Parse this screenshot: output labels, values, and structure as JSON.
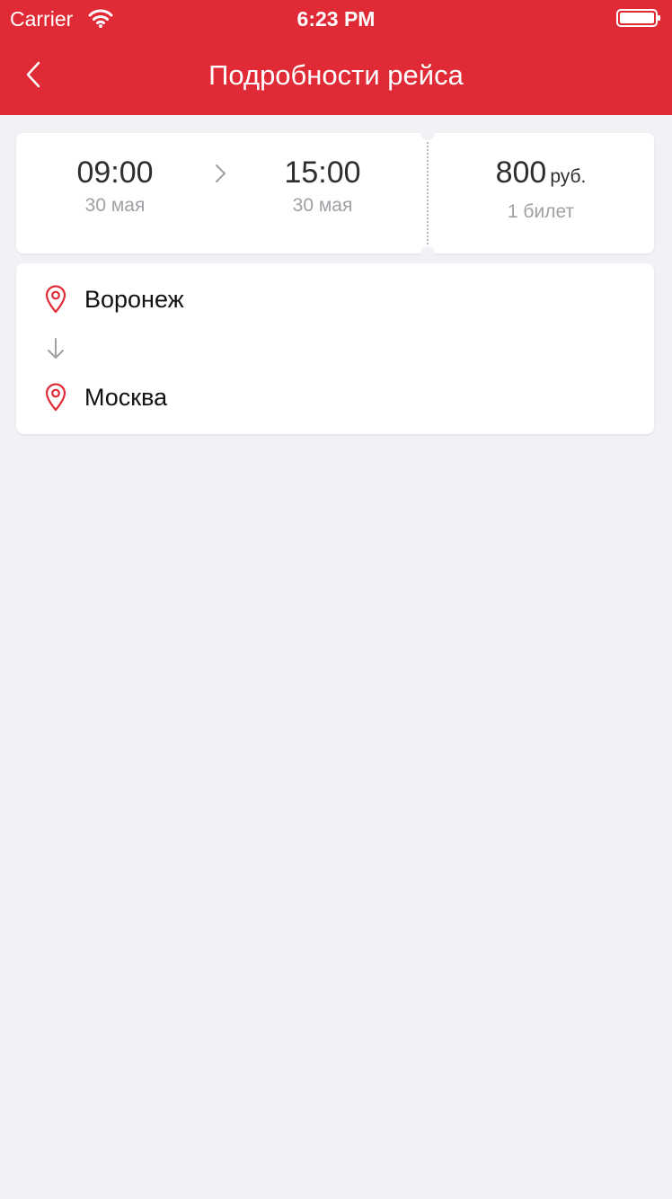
{
  "status_bar": {
    "carrier": "Carrier",
    "time": "6:23 PM",
    "wifi_icon": "wifi-icon",
    "battery_icon": "battery-icon"
  },
  "nav": {
    "title": "Подробности рейса",
    "back_icon": "chevron-left-icon"
  },
  "trip": {
    "departure": {
      "time": "09:00",
      "date": "30 мая"
    },
    "arrival": {
      "time": "15:00",
      "date": "30 мая"
    },
    "price": {
      "amount": "800",
      "currency": "руб.",
      "tickets": "1 билет"
    }
  },
  "route": {
    "from": "Воронеж",
    "to": "Москва",
    "pin_icon": "map-pin-icon",
    "direction_icon": "arrow-down-icon"
  },
  "colors": {
    "accent": "#e02b36",
    "background": "#f2f1f5",
    "card": "#ffffff",
    "primary_text": "#2e2e2e",
    "secondary_text": "#a0a0a5"
  }
}
